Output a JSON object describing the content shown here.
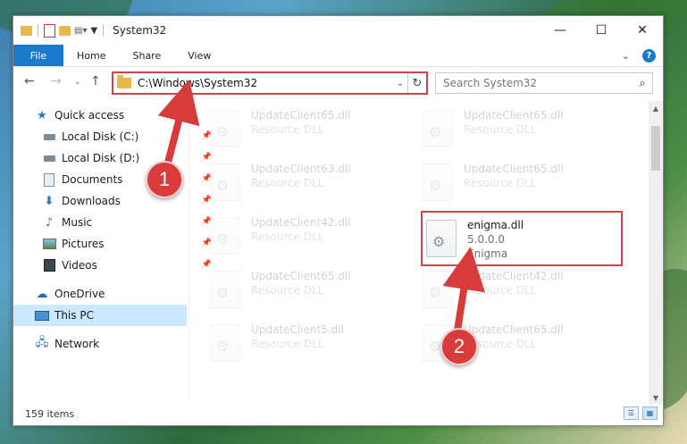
{
  "window": {
    "title": "System32",
    "controls": {
      "minimize": "—",
      "maximize": "☐",
      "close": "✕"
    }
  },
  "ribbon": {
    "file_tab": "File",
    "tabs": [
      "Home",
      "Share",
      "View"
    ],
    "expand_icon": "chevron-down-icon",
    "help_label": "?"
  },
  "address": {
    "path": "C:\\Windows\\System32",
    "search_placeholder": "Search System32"
  },
  "sidebar": {
    "items": [
      {
        "label": "Quick access",
        "icon": "star-icon",
        "pinned": false
      },
      {
        "label": "Local Disk (C:)",
        "icon": "drive-icon",
        "pinned": true
      },
      {
        "label": "Local Disk (D:)",
        "icon": "drive-icon",
        "pinned": true
      },
      {
        "label": "Documents",
        "icon": "documents-icon",
        "pinned": true
      },
      {
        "label": "Downloads",
        "icon": "downloads-icon",
        "pinned": true
      },
      {
        "label": "Music",
        "icon": "music-icon",
        "pinned": true
      },
      {
        "label": "Pictures",
        "icon": "pictures-icon",
        "pinned": true
      },
      {
        "label": "Videos",
        "icon": "videos-icon",
        "pinned": true
      },
      {
        "label": "OneDrive",
        "icon": "cloud-icon",
        "pinned": false
      },
      {
        "label": "This PC",
        "icon": "computer-icon",
        "pinned": false,
        "selected": true
      },
      {
        "label": "Network",
        "icon": "network-icon",
        "pinned": false
      }
    ]
  },
  "files": [
    {
      "name": "UpdateClient65.dll",
      "type": "Resource DLL"
    },
    {
      "name": "UpdateClient65.dll",
      "type": "Resource DLL"
    },
    {
      "name": "UpdateClient63.dll",
      "type": "Resource DLL"
    },
    {
      "name": "UpdateClient65.dll",
      "type": "Resource DLL"
    },
    {
      "name": "UpdateClient42.dll",
      "type": "Resource DLL"
    },
    {
      "name": "enigma.dll",
      "version": "5.0.0.0",
      "type": "Enigma"
    },
    {
      "name": "UpdateClient65.dll",
      "type": "Resource DLL"
    },
    {
      "name": "UpdateClient42.dll",
      "type": "Resource DLL"
    },
    {
      "name": "UpdateClient5.dll",
      "type": "Resource DLL"
    },
    {
      "name": "UpdateClient65.dll",
      "type": "Resource DLL"
    }
  ],
  "status": {
    "item_count": "159 items"
  },
  "annotations": {
    "step1": "1",
    "step2": "2"
  },
  "colors": {
    "accent": "#1979ca",
    "highlight": "#d94141",
    "selected": "#cce8ff"
  }
}
